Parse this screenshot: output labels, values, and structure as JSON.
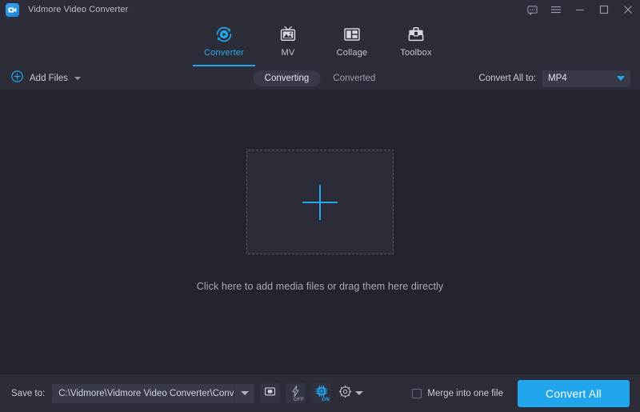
{
  "titlebar": {
    "app_title": "Vidmore Video Converter",
    "logo_icon": "video-camera-logo",
    "controls": [
      {
        "name": "feedback-icon",
        "label": ""
      },
      {
        "name": "menu-icon",
        "label": ""
      },
      {
        "name": "minimize-icon",
        "label": ""
      },
      {
        "name": "maximize-icon",
        "label": ""
      },
      {
        "name": "close-icon",
        "label": ""
      }
    ]
  },
  "tabs": [
    {
      "label": "Converter",
      "icon": "converter-icon",
      "active": true
    },
    {
      "label": "MV",
      "icon": "mv-icon",
      "active": false
    },
    {
      "label": "Collage",
      "icon": "collage-icon",
      "active": false
    },
    {
      "label": "Toolbox",
      "icon": "toolbox-icon",
      "active": false
    }
  ],
  "toolbar": {
    "add_files_label": "Add Files",
    "add_files_icon": "plus-circle-icon",
    "add_files_caret": "chevron-down-icon",
    "segments": [
      {
        "label": "Converting",
        "active": true
      },
      {
        "label": "Converted",
        "active": false
      }
    ],
    "convert_all_to_label": "Convert All to:",
    "format_value": "MP4",
    "format_caret": "chevron-down-icon"
  },
  "content": {
    "dropzone_icon": "plus-icon",
    "hint_text": "Click here to add media files or drag them here directly"
  },
  "bottombar": {
    "save_to_label": "Save to:",
    "save_path": "C:\\Vidmore\\Vidmore Video Converter\\Converted",
    "path_caret": "chevron-down-icon",
    "folder_icon": "folder-open-icon",
    "accel_toggle": {
      "icon": "lightning-bolt-icon",
      "state": "OFF"
    },
    "gpu_toggle": {
      "icon": "cpu-chip-icon",
      "state": "ON"
    },
    "settings_icon": "gear-icon",
    "settings_caret": "chevron-down-icon",
    "merge_label": "Merge into one file",
    "merge_checked": false,
    "convert_all_button": "Convert All"
  },
  "colors": {
    "accent": "#21a5ed",
    "titlebar_bg": "#2c2d38",
    "content_bg": "#24242e",
    "panel_bg": "#383a47",
    "text_primary": "#e2e5ec",
    "text_secondary": "#9aa0ae"
  }
}
